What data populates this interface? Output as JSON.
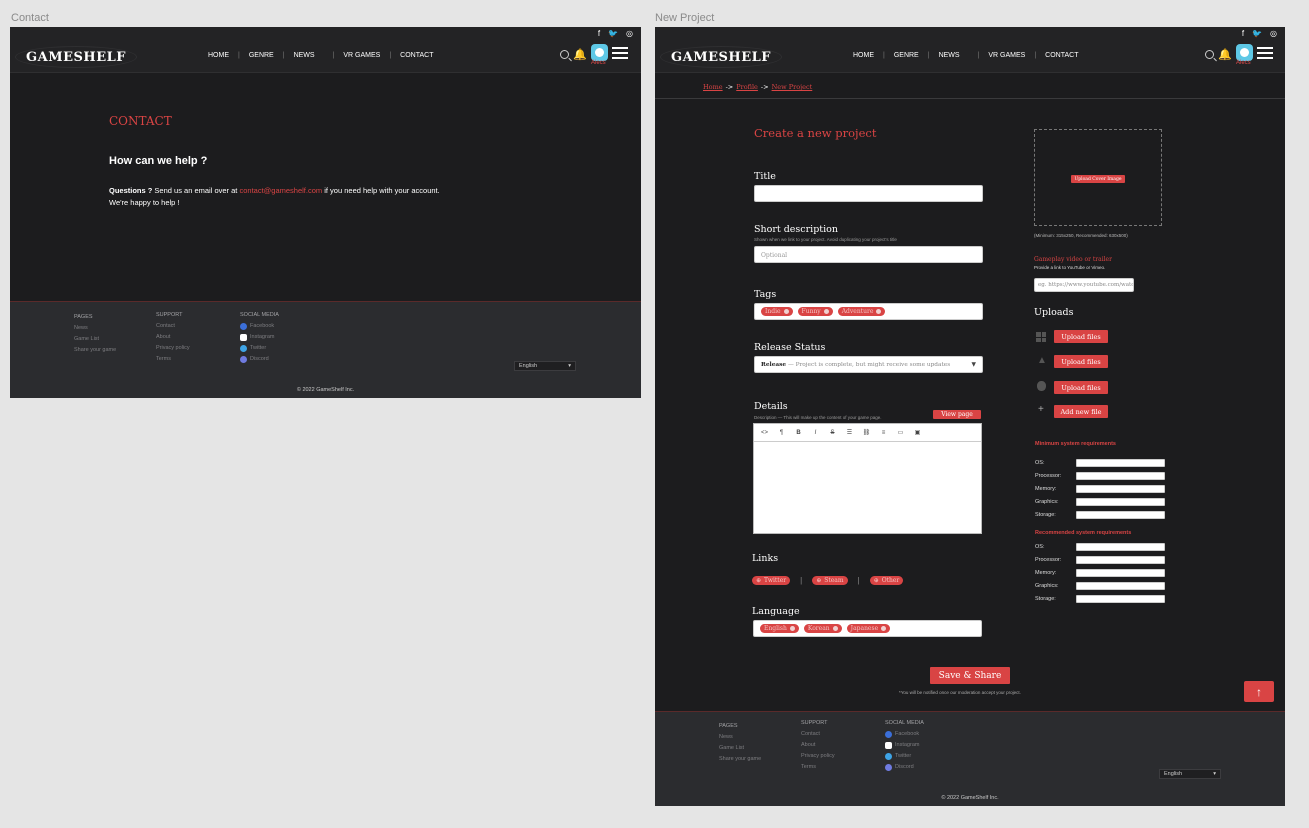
{
  "frames": {
    "contact_label": "Contact",
    "project_label": "New Project"
  },
  "social_top": [
    "f",
    "🐦",
    "◎"
  ],
  "nav": {
    "logo": "GAMESHELF",
    "links": [
      "HOME",
      "GENRE",
      "NEWS",
      "VR GAMES",
      "CONTACT"
    ],
    "user": "Alecs"
  },
  "contact": {
    "title": "CONTACT",
    "heading": "How can we help ?",
    "questions_bold": "Questions ?",
    "text_before": " Send us an email over at ",
    "email": "contact@gameshelf.com",
    "text_after": " if you need help with your account.",
    "line2": "We're happy to help !"
  },
  "footer": {
    "pages_head": "PAGES",
    "pages": [
      "News",
      "Game List",
      "Share your game"
    ],
    "support_head": "SUPPORT",
    "support": [
      "Contact",
      "About",
      "Privacy policy",
      "Terms"
    ],
    "social_head": "SOCIAL MEDIA",
    "social": [
      "Facebook",
      "Instagram",
      "Twitter",
      "Discord"
    ],
    "language": "English",
    "copyright": "© 2022 GameShelf Inc."
  },
  "breadcrumb": [
    "Home",
    "Profile",
    "New Project"
  ],
  "breadcrumb_sep": "->",
  "project": {
    "heading": "Create a new project",
    "title_label": "Title",
    "short_desc_label": "Short description",
    "short_desc_hint": "Shown when we link to your project. Avoid duplicating your project's title",
    "short_desc_placeholder": "Optional",
    "tags_label": "Tags",
    "tags": [
      "Indie",
      "Funny",
      "Adventure"
    ],
    "release_label": "Release Status",
    "release_value_bold": "Release",
    "release_value_rest": " — Project is complete, but might receive some updates",
    "details_label": "Details",
    "details_hint": "Description — This will make up the content of your game page.",
    "view_page": "View page",
    "toolbar": [
      "<>",
      "¶",
      "B",
      "I",
      "S",
      "☰",
      "⛓",
      "≡",
      "▭",
      "▣"
    ],
    "links_label": "Links",
    "links": [
      "Twitter",
      "Steam",
      "Other"
    ],
    "language_label": "Language",
    "languages": [
      "English",
      "Korean",
      "Japanese"
    ],
    "save_button": "Save & Share",
    "save_note": "*You will be notified once our moderation accept your project.",
    "cover_button": "Upload Cover Image",
    "cover_hint": "(Minimum: 315x250, Recommended: 630x500)",
    "video_label": "Gameplay video or trailer",
    "video_hint": "Provide a link to YouTube or Vimeo.",
    "video_placeholder": "eg. https://www.youtube.com/watch?v=d",
    "uploads_label": "Uploads",
    "upload_buttons": [
      "Upload files",
      "Upload files",
      "Upload files"
    ],
    "add_file": "Add new file",
    "min_req_label": "Minimum system requirements",
    "rec_req_label": "Recommended system requirements",
    "spec_fields": [
      "OS:",
      "Processor:",
      "Memory:",
      "Graphics:",
      "Storage:"
    ]
  },
  "colors": {
    "accent": "#d94444",
    "background": "#1c1c1e",
    "footer": "#2b2c2f",
    "canvas": "#e5e5e5"
  }
}
